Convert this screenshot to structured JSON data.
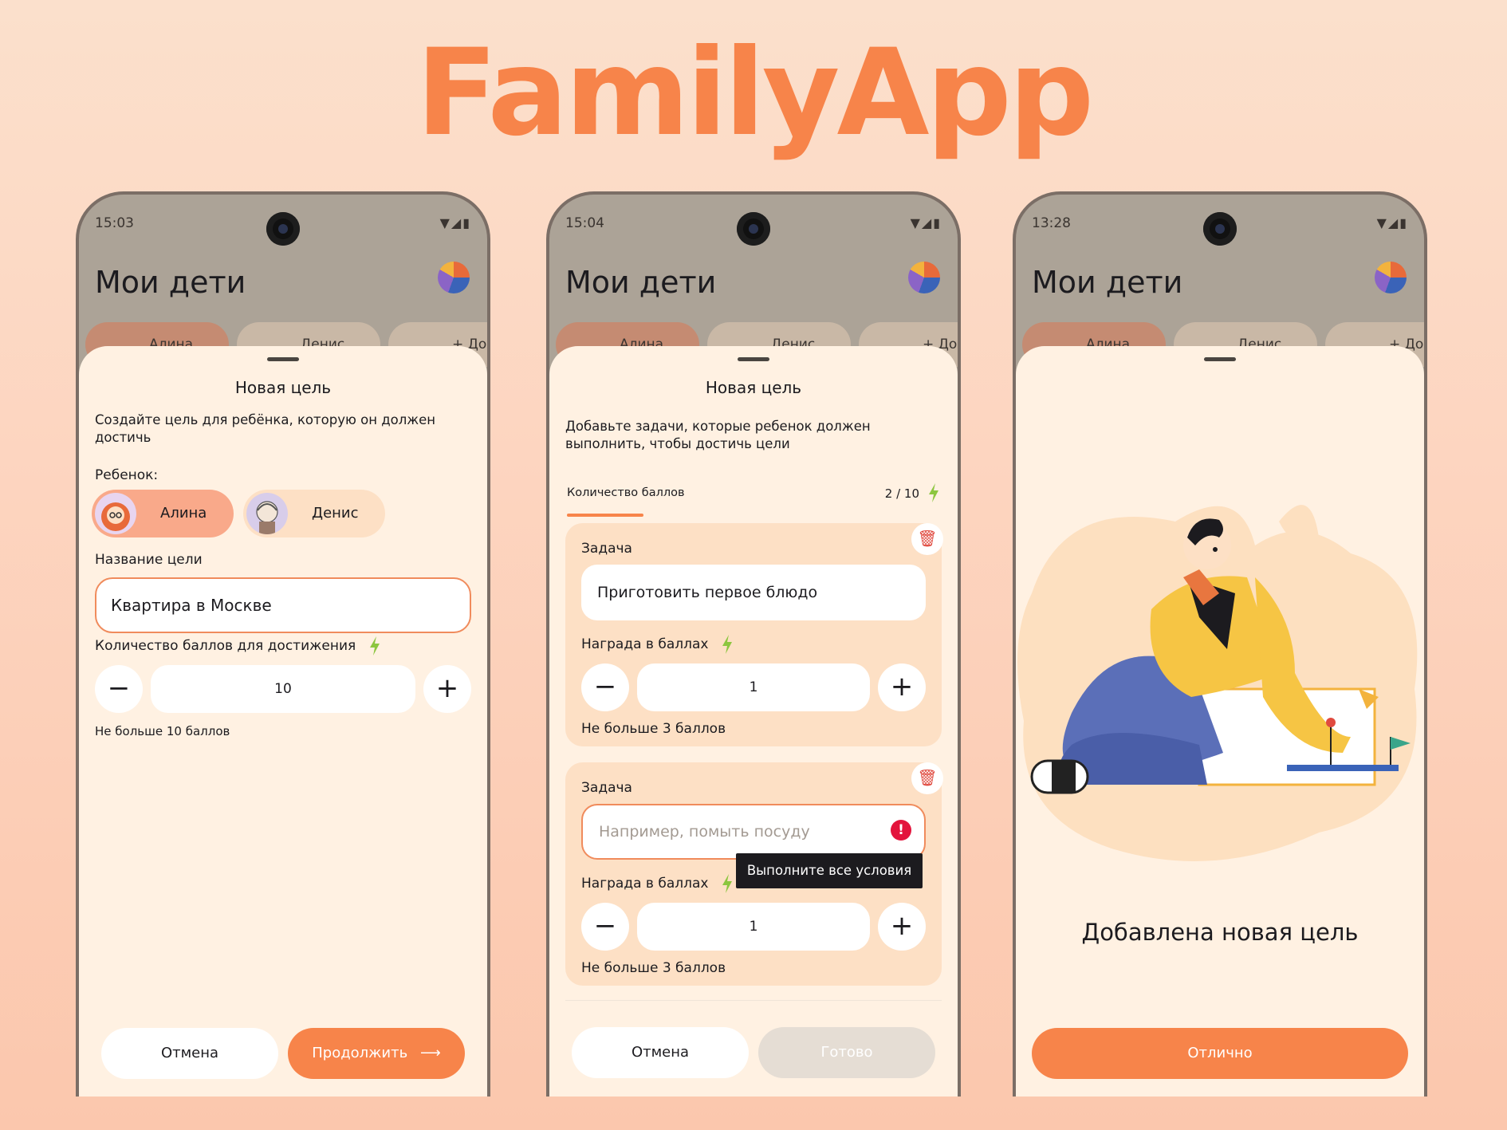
{
  "brand": "FamilyApp",
  "colors": {
    "accent": "#f7844a",
    "sheet": "#fff1e2",
    "task_card": "#fde0c5",
    "error": "#e3143c",
    "bolt": "#8cc63f"
  },
  "screens": [
    {
      "time": "15:03",
      "bg_title": "Мои дети",
      "bg_chips": [
        "Алина",
        "Денис",
        "+ Добавить"
      ],
      "sheet_title": "Новая цель",
      "description": "Создайте цель для ребёнка, которую он должен достичь",
      "child_label": "Ребенок:",
      "children": [
        "Алина",
        "Денис"
      ],
      "goal_name_label": "Название цели",
      "goal_name_value": "Квартира в Москве",
      "points_label": "Количество баллов для достижения",
      "points_minus": "−",
      "points_value": "10",
      "points_plus": "+",
      "points_hint": "Не больше 10 баллов",
      "cancel": "Отмена",
      "continue": "Продолжить",
      "continue_icon": "arrow-right-icon"
    },
    {
      "time": "15:04",
      "bg_title": "Мои дети",
      "bg_chips": [
        "Алина",
        "Денис",
        "+ Добавить"
      ],
      "sheet_title": "Новая цель",
      "description": "Добавьте задачи, которые ребенок должен выполнить, чтобы достичь цели",
      "tab_label": "Количество баллов",
      "points_counter": "2  /  10",
      "tasks": [
        {
          "label": "Задача",
          "value": "Приготовить первое блюдо",
          "reward_label": "Награда в баллах",
          "minus": "−",
          "reward_value": "1",
          "plus": "+",
          "hint": "Не больше 3 баллов"
        },
        {
          "label": "Задача",
          "placeholder": "Например, помыть посуду",
          "error_tooltip": "Выполните все условия",
          "reward_label": "Награда в баллах",
          "minus": "−",
          "reward_value": "1",
          "plus": "+",
          "hint": "Не больше 3 баллов"
        }
      ],
      "cancel": "Отмена",
      "done": "Готово"
    },
    {
      "time": "13:28",
      "bg_title": "Мои дети",
      "bg_chips": [
        "Алина",
        "Денис",
        "+ Добавить"
      ],
      "success_text": "Добавлена новая цель",
      "ok": "Отлично"
    }
  ]
}
